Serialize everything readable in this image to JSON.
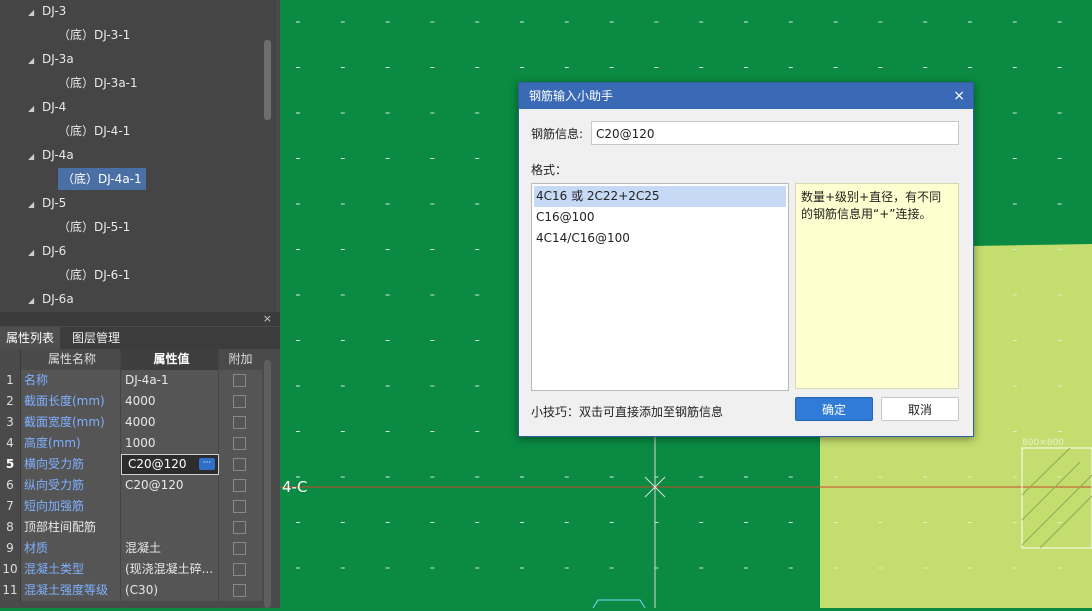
{
  "tree": {
    "items": [
      {
        "label": "DJ-3",
        "kind": "parent"
      },
      {
        "label": "（底）DJ-3-1",
        "kind": "child"
      },
      {
        "label": "DJ-3a",
        "kind": "parent"
      },
      {
        "label": "（底）DJ-3a-1",
        "kind": "child"
      },
      {
        "label": "DJ-4",
        "kind": "parent"
      },
      {
        "label": "（底）DJ-4-1",
        "kind": "child"
      },
      {
        "label": "DJ-4a",
        "kind": "parent"
      },
      {
        "label": "（底）DJ-4a-1",
        "kind": "child",
        "selected": true
      },
      {
        "label": "DJ-5",
        "kind": "parent"
      },
      {
        "label": "（底）DJ-5-1",
        "kind": "child"
      },
      {
        "label": "DJ-6",
        "kind": "parent"
      },
      {
        "label": "（底）DJ-6-1",
        "kind": "child"
      },
      {
        "label": "DJ-6a",
        "kind": "parent"
      }
    ],
    "close_glyph": "×"
  },
  "tabs": {
    "properties": "属性列表",
    "layers": "图层管理"
  },
  "props": {
    "headers": {
      "name": "属性名称",
      "value": "属性值",
      "extra": "附加"
    },
    "rows": [
      {
        "num": "1",
        "name": "名称",
        "value": "DJ-4a-1"
      },
      {
        "num": "2",
        "name": "截面长度(mm)",
        "value": "4000"
      },
      {
        "num": "3",
        "name": "截面宽度(mm)",
        "value": "4000"
      },
      {
        "num": "4",
        "name": "高度(mm)",
        "value": "1000"
      },
      {
        "num": "5",
        "name": "横向受力筋",
        "value": "C20@120"
      },
      {
        "num": "6",
        "name": "纵向受力筋",
        "value": "C20@120"
      },
      {
        "num": "7",
        "name": "短向加强筋",
        "value": ""
      },
      {
        "num": "8",
        "name": "顶部柱间配筋",
        "value": ""
      },
      {
        "num": "9",
        "name": "材质",
        "value": "混凝土"
      },
      {
        "num": "10",
        "name": "混凝土类型",
        "value": "(现浇混凝土碎..."
      },
      {
        "num": "11",
        "name": "混凝土强度等级",
        "value": "(C30)"
      }
    ],
    "edit_button_glyph": "···"
  },
  "canvas": {
    "axis_label": "4-C",
    "small_label": "800×800",
    "colors": {
      "green": "#0a8a42",
      "light": "#c3dd6e",
      "axis": "#c84a2a"
    }
  },
  "dialog": {
    "title": "钢筋输入小助手",
    "close_glyph": "×",
    "info_label": "钢筋信息:",
    "info_value": "C20@120",
    "format_label": "格式：",
    "formats": [
      "4C16 或 2C22+2C25",
      "C16@100",
      "4C14/C16@100"
    ],
    "note": "数量+级别+直径，有不同的钢筋信息用“+”连接。",
    "tip": "小技巧：双击可直接添加至钢筋信息",
    "ok": "确定",
    "cancel": "取消"
  }
}
